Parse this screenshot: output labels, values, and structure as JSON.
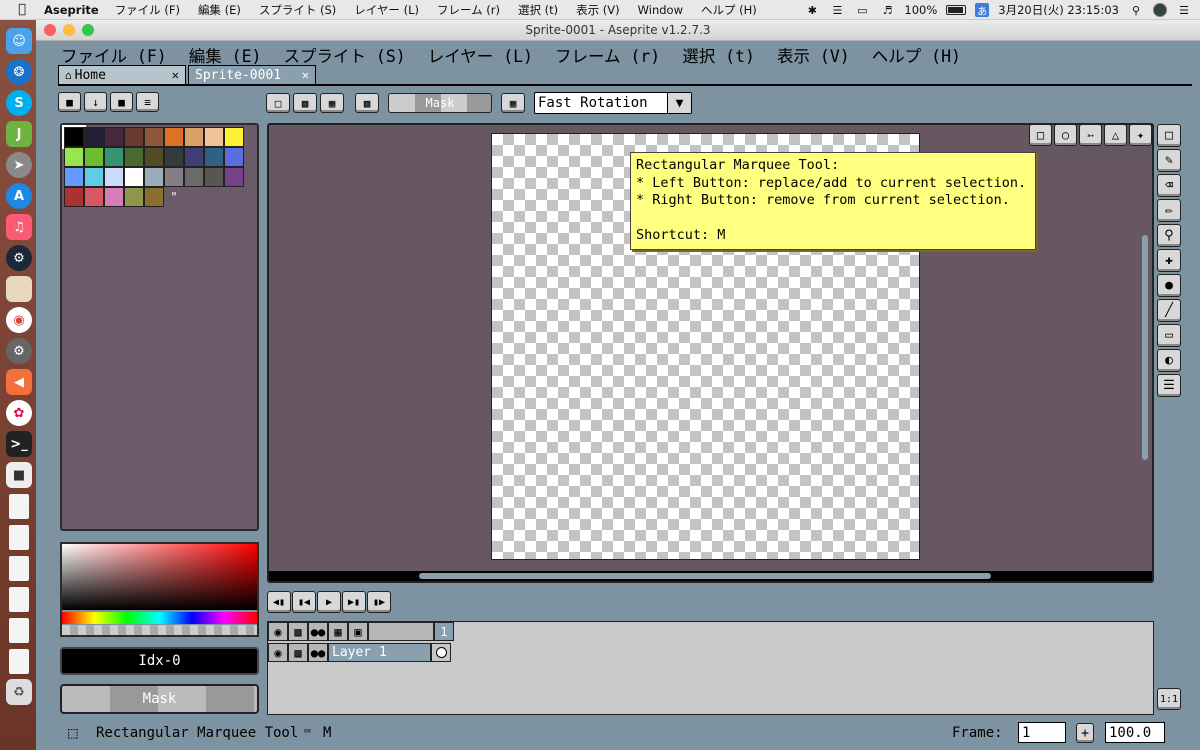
{
  "mac_menubar": {
    "app_name": "Aseprite",
    "menus": [
      "ファイル (F)",
      "編集 (E)",
      "スプライト (S)",
      "レイヤー (L)",
      "フレーム (r)",
      "選択 (t)",
      "表示 (V)",
      "Window",
      "ヘルプ (H)"
    ],
    "battery": "100%",
    "ime": "あ",
    "clock": "3月20日(火)  23:15:03"
  },
  "window": {
    "title": "Sprite-0001 - Aseprite v1.2.7.3"
  },
  "app_menu": [
    "ファイル (F)",
    "編集 (E)",
    "スプライト (S)",
    "レイヤー (L)",
    "フレーム (r)",
    "選択 (t)",
    "表示 (V)",
    "ヘルプ (H)"
  ],
  "tabs": [
    {
      "label": "Home",
      "icon": "home-icon",
      "active": false
    },
    {
      "label": "Sprite-0001",
      "active": true
    }
  ],
  "palette": {
    "colors": [
      "#000000",
      "#222034",
      "#45283c",
      "#663931",
      "#8f563b",
      "#df7126",
      "#d9a066",
      "#eec39a",
      "#fbf236",
      "#99e550",
      "#6abe30",
      "#37946e",
      "#4b692f",
      "#524b24",
      "#323c39",
      "#3f3f74",
      "#306082",
      "#5b6ee1",
      "#639bff",
      "#5fcde4",
      "#cbdbfc",
      "#ffffff",
      "#9badb7",
      "#847e87",
      "#696a6a",
      "#595652",
      "#76428a",
      "#ac3232",
      "#d95763",
      "#d77bba",
      "#8f974a",
      "#8a6f30"
    ],
    "overflow_mark": "\""
  },
  "color_bar": {
    "index_label": "Idx-0",
    "mask_label": "Mask"
  },
  "context_bar": {
    "mask_label": "Mask",
    "rotation_algorithm": "Fast Rotation"
  },
  "tooltip": {
    "text": "Rectangular Marquee Tool:\n* Left Button: replace/add to current selection.\n* Right Button: remove from current selection.\n\nShortcut: M"
  },
  "timeline": {
    "frame_header": "1",
    "layers": [
      {
        "name": "Layer 1"
      }
    ]
  },
  "status_bar": {
    "tool_name": "Rectangular Marquee Tool",
    "shortcut": "M",
    "frame_label": "Frame:",
    "frame_value": "1",
    "zoom_value": "100.0"
  }
}
